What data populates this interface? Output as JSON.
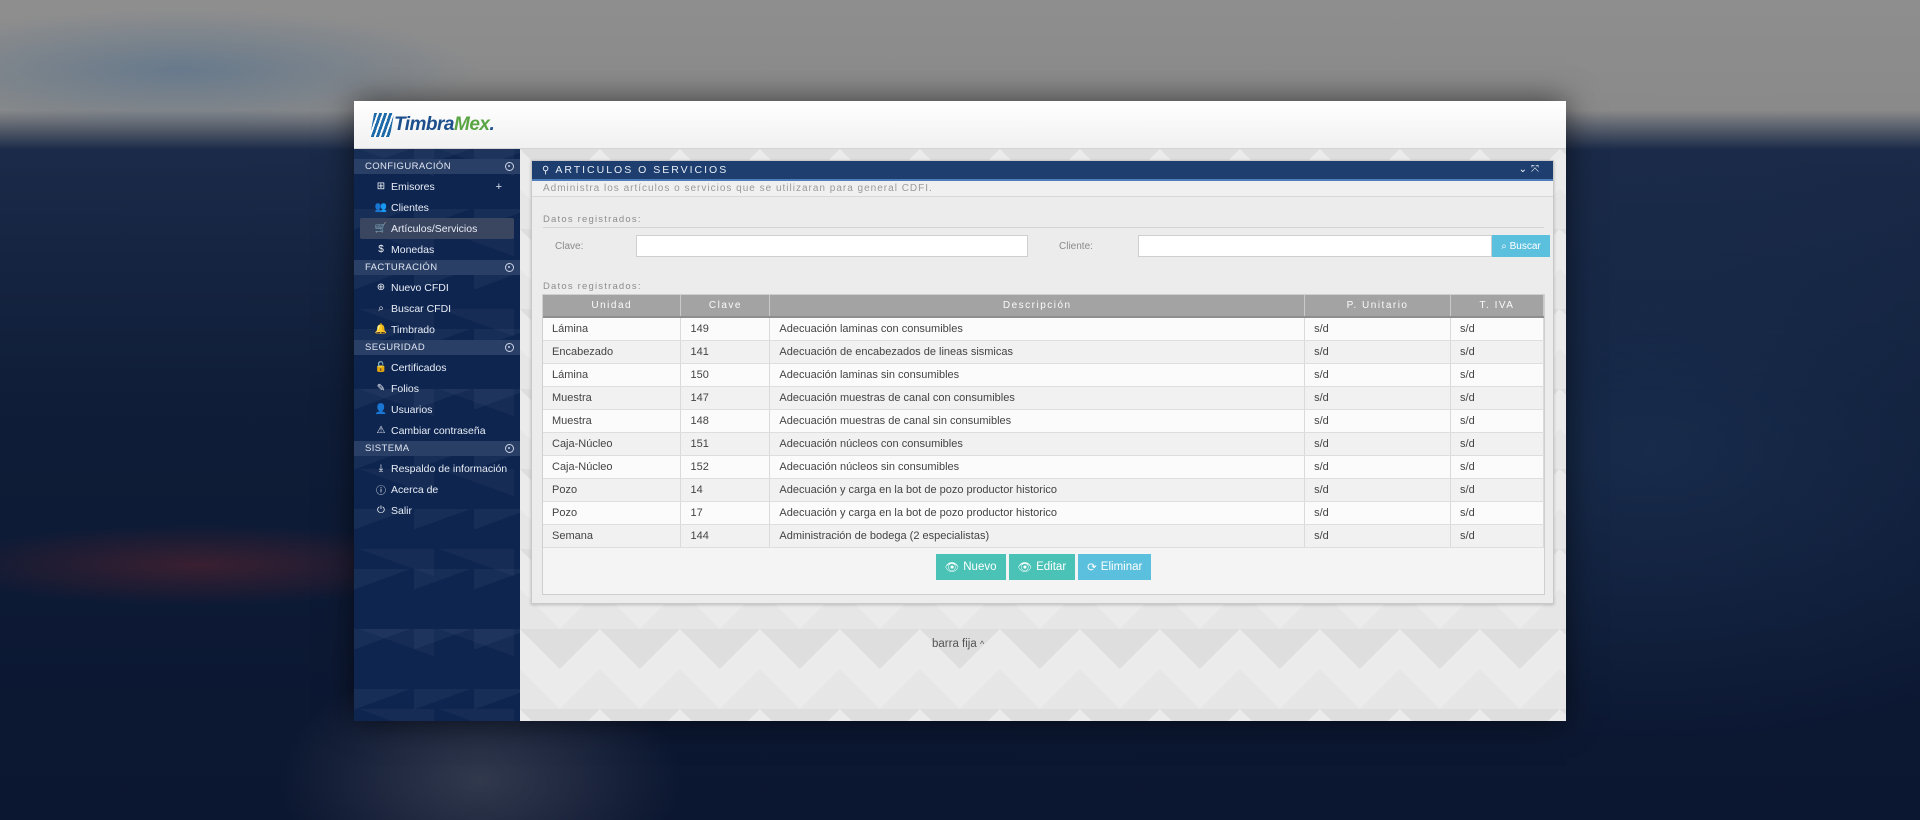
{
  "brand": {
    "name_part1": "Timbra",
    "name_part2": "Mex",
    "name_dot": "."
  },
  "sidebar": {
    "sections": [
      {
        "title": "CONFIGURACIÓN",
        "items": [
          {
            "label": "Emisores",
            "icon": "sitemap-icon",
            "glyph": "⊞",
            "has_plus": true
          },
          {
            "label": "Clientes",
            "icon": "users-icon",
            "glyph": "👥"
          },
          {
            "label": "Artículos/Servicios",
            "icon": "cart-icon",
            "glyph": "🛒",
            "active": true
          },
          {
            "label": "Monedas",
            "icon": "dollar-icon",
            "glyph": "$"
          }
        ]
      },
      {
        "title": "FACTURACIÓN",
        "items": [
          {
            "label": "Nuevo CFDI",
            "icon": "plus-square-icon",
            "glyph": "⊕"
          },
          {
            "label": "Buscar CFDI",
            "icon": "search-icon",
            "glyph": "⌕"
          },
          {
            "label": "Timbrado",
            "icon": "bell-icon",
            "glyph": "🔔"
          }
        ]
      },
      {
        "title": "SEGURIDAD",
        "items": [
          {
            "label": "Certificados",
            "icon": "unlock-icon",
            "glyph": "🔓"
          },
          {
            "label": "Folios",
            "icon": "tag-icon",
            "glyph": "✎"
          },
          {
            "label": "Usuarios",
            "icon": "user-icon",
            "glyph": "👤"
          },
          {
            "label": "Cambiar contraseña",
            "icon": "warning-icon",
            "glyph": "⚠"
          }
        ]
      },
      {
        "title": "SISTEMA",
        "items": [
          {
            "label": "Respaldo de información",
            "icon": "download-icon",
            "glyph": "⤓"
          },
          {
            "label": "Acerca de",
            "icon": "info-icon",
            "glyph": "ⓘ"
          },
          {
            "label": "Salir",
            "icon": "power-icon",
            "glyph": "⏻"
          }
        ]
      }
    ],
    "plus": "+"
  },
  "panel": {
    "title": "ARTICULOS O SERVICIOS",
    "subtitle": "Administra los artículos o servicios que se utilizaran para general CDFI.",
    "filter_section": "Datos registrados:",
    "clave_label": "Clave:",
    "clave_value": "",
    "cliente_label": "Cliente:",
    "cliente_value": "",
    "search_button": "Buscar",
    "table_section": "Datos registrados:",
    "columns": [
      "Unidad",
      "Clave",
      "Descripción",
      "P. Unitario",
      "T. IVA"
    ],
    "rows": [
      [
        "Lámina",
        "149",
        "Adecuación laminas con consumibles",
        "s/d",
        "s/d"
      ],
      [
        "Encabezado",
        "141",
        "Adecuación de encabezados de lineas sismicas",
        "s/d",
        "s/d"
      ],
      [
        "Lámina",
        "150",
        "Adecuación laminas sin consumibles",
        "s/d",
        "s/d"
      ],
      [
        "Muestra",
        "147",
        "Adecuación muestras de canal con consumibles",
        "s/d",
        "s/d"
      ],
      [
        "Muestra",
        "148",
        "Adecuación muestras de canal sin consumibles",
        "s/d",
        "s/d"
      ],
      [
        "Caja-Núcleo",
        "151",
        "Adecuación núcleos con consumibles",
        "s/d",
        "s/d"
      ],
      [
        "Caja-Núcleo",
        "152",
        "Adecuación núcleos sin consumibles",
        "s/d",
        "s/d"
      ],
      [
        "Pozo",
        "14",
        "Adecuación y carga en la bot de pozo productor historico",
        "s/d",
        "s/d"
      ],
      [
        "Pozo",
        "17",
        "Adecuación y carga en la bot de pozo productor historico",
        "s/d",
        "s/d"
      ],
      [
        "Semana",
        "144",
        "Administración de bodega (2 especialistas)",
        "s/d",
        "s/d"
      ]
    ],
    "buttons": {
      "nuevo": "Nuevo",
      "editar": "Editar",
      "eliminar": "Eliminar"
    }
  },
  "footer": {
    "label": "barra fija",
    "caret": "^"
  },
  "colors": {
    "header_blue": "#1d3e6e",
    "sidebar_bg": "#0e2550",
    "teal": "#4ac2b6",
    "info": "#5bc0de",
    "active_icon": "#e0483e"
  }
}
